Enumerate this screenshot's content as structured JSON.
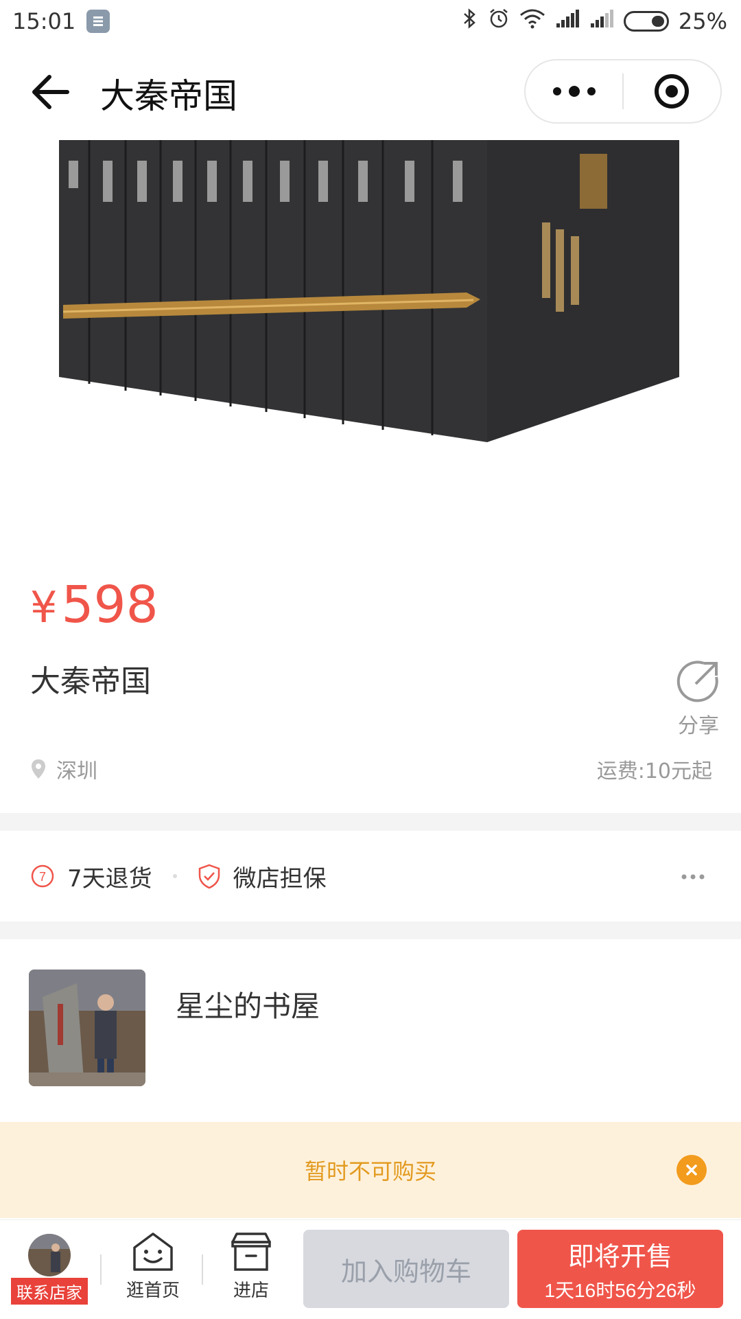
{
  "status_bar": {
    "time": "15:01",
    "battery": "25%"
  },
  "nav": {
    "title": "大秦帝国"
  },
  "product": {
    "currency": "¥",
    "price": "598",
    "title": "大秦帝国",
    "share_label": "分享",
    "location": "深圳",
    "shipping": "运费:10元起"
  },
  "guarantees": {
    "return_badge": "7",
    "return_label": "7天退货",
    "guarantee_label": "微店担保"
  },
  "shop": {
    "name": "星尘的书屋"
  },
  "notice": {
    "text": "暂时不可购买"
  },
  "bottom_bar": {
    "contact_label": "联系店家",
    "home_label": "逛首页",
    "store_label": "进店",
    "cart_button": "加入购物车",
    "sale_button": "即将开售",
    "countdown": "1天16时56分26秒"
  },
  "colors": {
    "accent": "#f0554a",
    "notice_bg": "#fef1dc",
    "notice_text": "#e29a1f"
  }
}
